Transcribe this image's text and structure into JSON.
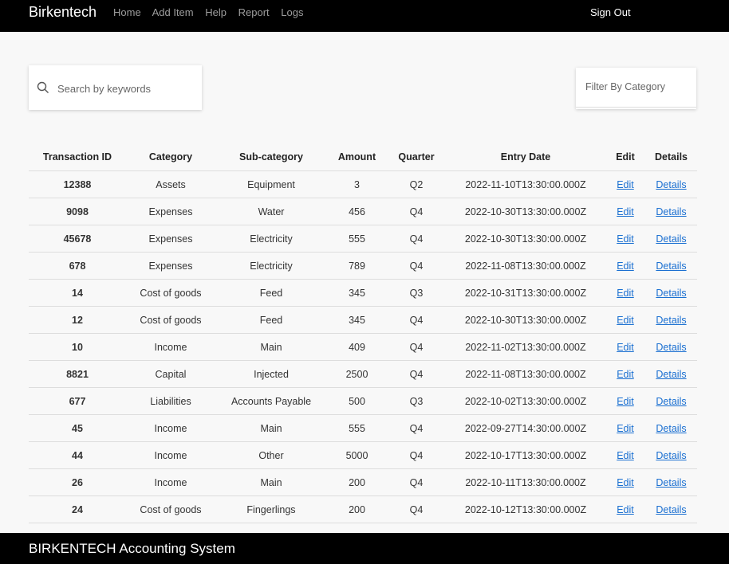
{
  "nav": {
    "brand": "Birkentech",
    "links": [
      "Home",
      "Add Item",
      "Help",
      "Report",
      "Logs"
    ],
    "signout": "Sign Out"
  },
  "search": {
    "placeholder": "Search by keywords",
    "value": "",
    "icon": "search-icon"
  },
  "filter": {
    "placeholder": "Filter By Category"
  },
  "table": {
    "headers": [
      "Transaction ID",
      "Category",
      "Sub-category",
      "Amount",
      "Quarter",
      "Entry Date",
      "Edit",
      "Details"
    ],
    "rows": [
      [
        "12388",
        "Assets",
        "Equipment",
        "3",
        "Q2",
        "2022-11-10T13:30:00.000Z",
        "Edit",
        "Details"
      ],
      [
        "9098",
        "Expenses",
        "Water",
        "456",
        "Q4",
        "2022-10-30T13:30:00.000Z",
        "Edit",
        "Details"
      ],
      [
        "45678",
        "Expenses",
        "Electricity",
        "555",
        "Q4",
        "2022-10-30T13:30:00.000Z",
        "Edit",
        "Details"
      ],
      [
        "678",
        "Expenses",
        "Electricity",
        "789",
        "Q4",
        "2022-11-08T13:30:00.000Z",
        "Edit",
        "Details"
      ],
      [
        "14",
        "Cost of goods",
        "Feed",
        "345",
        "Q3",
        "2022-10-31T13:30:00.000Z",
        "Edit",
        "Details"
      ],
      [
        "12",
        "Cost of goods",
        "Feed",
        "345",
        "Q4",
        "2022-10-30T13:30:00.000Z",
        "Edit",
        "Details"
      ],
      [
        "10",
        "Income",
        "Main",
        "409",
        "Q4",
        "2022-11-02T13:30:00.000Z",
        "Edit",
        "Details"
      ],
      [
        "8821",
        "Capital",
        "Injected",
        "2500",
        "Q4",
        "2022-11-08T13:30:00.000Z",
        "Edit",
        "Details"
      ],
      [
        "677",
        "Liabilities",
        "Accounts Payable",
        "500",
        "Q3",
        "2022-10-02T13:30:00.000Z",
        "Edit",
        "Details"
      ],
      [
        "45",
        "Income",
        "Main",
        "555",
        "Q4",
        "2022-09-27T14:30:00.000Z",
        "Edit",
        "Details"
      ],
      [
        "44",
        "Income",
        "Other",
        "5000",
        "Q4",
        "2022-10-17T13:30:00.000Z",
        "Edit",
        "Details"
      ],
      [
        "26",
        "Income",
        "Main",
        "200",
        "Q4",
        "2022-10-11T13:30:00.000Z",
        "Edit",
        "Details"
      ],
      [
        "24",
        "Cost of goods",
        "Fingerlings",
        "200",
        "Q4",
        "2022-10-12T13:30:00.000Z",
        "Edit",
        "Details"
      ]
    ]
  },
  "footer": {
    "text": "BIRKENTECH Accounting System"
  },
  "colors": {
    "nav_bg": "#000000",
    "link": "#1a6fd1",
    "page_bg": "#f8f8f8"
  }
}
